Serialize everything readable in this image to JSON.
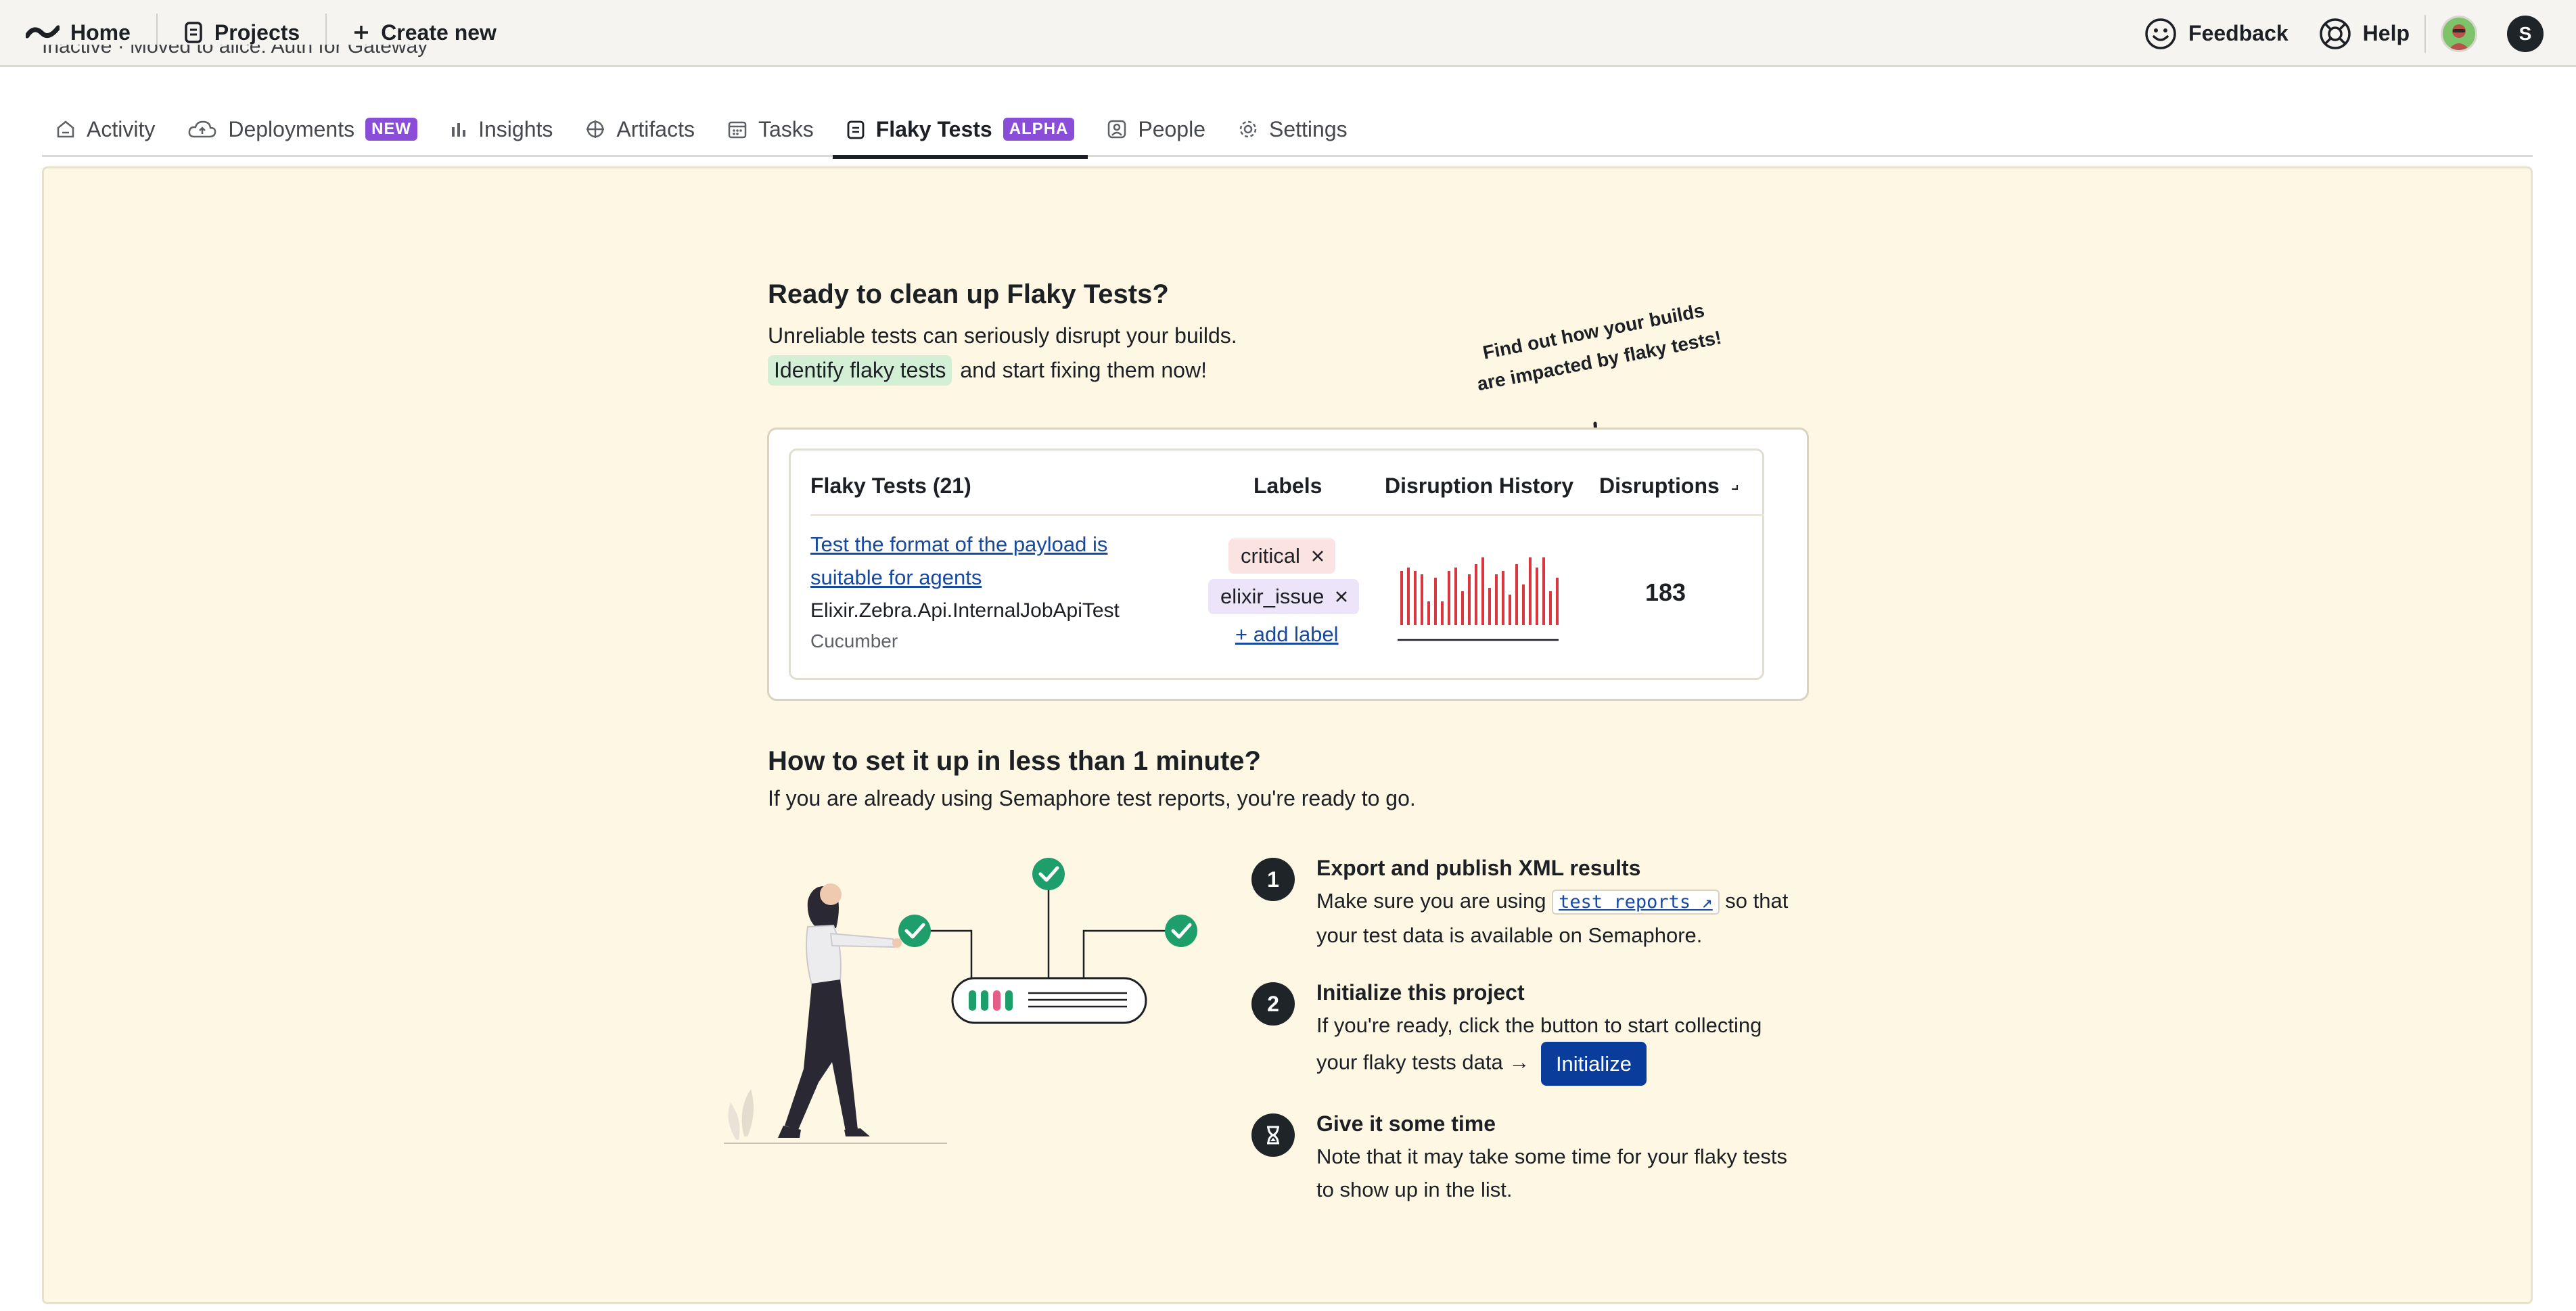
{
  "nav": {
    "home": "Home",
    "projects": "Projects",
    "create_new": "Create new",
    "feedback": "Feedback",
    "help": "Help",
    "user_initial": "S"
  },
  "breadcrumb_clipped": "Inactive · Moved to alice: Auth for Gateway",
  "tabs": [
    {
      "label": "Activity",
      "icon": "home-icon"
    },
    {
      "label": "Deployments",
      "icon": "cloud-icon",
      "badge": "NEW"
    },
    {
      "label": "Insights",
      "icon": "bar-chart-icon"
    },
    {
      "label": "Artifacts",
      "icon": "artifact-icon"
    },
    {
      "label": "Tasks",
      "icon": "calendar-icon"
    },
    {
      "label": "Flaky Tests",
      "icon": "clipboard-icon",
      "badge": "ALPHA",
      "active": true
    },
    {
      "label": "People",
      "icon": "person-icon"
    },
    {
      "label": "Settings",
      "icon": "gear-icon"
    }
  ],
  "intro": {
    "title": "Ready to clean up Flaky Tests?",
    "line1": "Unreliable tests can seriously disrupt your builds.",
    "highlight": "Identify flaky tests",
    "line2_rest": "and start fixing them now!",
    "callout_line1": "Find out how your builds",
    "callout_line2": "are impacted by flaky tests!"
  },
  "table": {
    "headers": {
      "tests": "Flaky Tests (21)",
      "labels": "Labels",
      "history": "Disruption History",
      "disruptions": "Disruptions"
    },
    "row": {
      "name": "Test the format of the payload is suitable for agents",
      "class": "Elixir.Zebra.Api.InternalJobApiTest",
      "suite": "Cucumber",
      "labels": [
        "critical",
        "elixir_issue"
      ],
      "add_label": "+ add label",
      "disruptions": "183",
      "history": [
        0.8,
        0.85,
        0.8,
        0.75,
        0.35,
        0.7,
        0.35,
        0.8,
        0.85,
        0.5,
        0.75,
        0.9,
        1.0,
        0.55,
        0.75,
        0.8,
        0.45,
        0.9,
        0.6,
        1.0,
        0.85,
        1.0,
        0.5,
        0.7
      ]
    }
  },
  "setup": {
    "title": "How to set it up in less than 1 minute?",
    "subtitle": "If you are already using Semaphore test reports, you're ready to go.",
    "steps": [
      {
        "num": "1",
        "title": "Export and publish XML results",
        "pre": "Make sure you are using",
        "code": "test reports ↗",
        "post": "so that your test data is available on Semaphore."
      },
      {
        "num": "2",
        "title": "Initialize this project",
        "text": "If you're ready, click the button to start collecting your flaky tests data →",
        "button": "Initialize"
      },
      {
        "num": "⧗",
        "title": "Give it some time",
        "text": "Note that it may take some time for your flaky tests to show up in the list."
      }
    ]
  },
  "colors": {
    "panel_bg": "#fdf7e4",
    "badge_purple": "#8a4dd8",
    "link_blue": "#17499e",
    "bar_red": "#d9363e",
    "check_green": "#1e9e6a",
    "button_blue": "#0a3d9b"
  }
}
